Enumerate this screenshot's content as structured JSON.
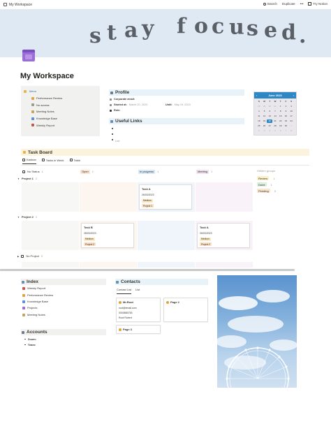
{
  "topbar": {
    "workspace": "My Workspace",
    "search": "Search",
    "duplicate": "Duplicate",
    "more": "•••",
    "try_notion": "Try Notion"
  },
  "cover": {
    "text": "stay focused."
  },
  "title": "My Workspace",
  "menu": {
    "label": "Menu",
    "items": [
      {
        "label": "Performance Review",
        "icon": "trophy-icon",
        "color": "#e3a33a"
      },
      {
        "label": "No access",
        "icon": "lock-icon",
        "color": "#9b9a97"
      },
      {
        "label": "Meeting Notes",
        "icon": "notes-icon",
        "color": "#c9a25b"
      },
      {
        "label": "Knowledge Base",
        "icon": "book-icon",
        "color": "#5b8fd6"
      },
      {
        "label": "Weekly Report",
        "icon": "report-icon",
        "color": "#d0534b"
      }
    ]
  },
  "profile": {
    "heading": "Profile",
    "email_label": "Corporate email:",
    "started_label": "Started at:",
    "started_value": "March 20, 2023",
    "until_label": "Until:",
    "until_value": "May 19, 2023",
    "role_label": "Role:"
  },
  "useful_links": {
    "heading": "Useful Links",
    "bullets": [
      "",
      "",
      ""
    ],
    "extra": "List"
  },
  "calendar": {
    "month": "June 2023",
    "prev": "‹",
    "next": "›",
    "dows": [
      "S",
      "M",
      "T",
      "W",
      "T",
      "F",
      "S"
    ],
    "days": [
      {
        "d": "28",
        "cls": "other"
      },
      {
        "d": "29",
        "cls": "other"
      },
      {
        "d": "30",
        "cls": "other"
      },
      {
        "d": "31",
        "cls": "other"
      },
      {
        "d": "1",
        "cls": ""
      },
      {
        "d": "2",
        "cls": ""
      },
      {
        "d": "3",
        "cls": ""
      },
      {
        "d": "4",
        "cls": ""
      },
      {
        "d": "5",
        "cls": ""
      },
      {
        "d": "6",
        "cls": ""
      },
      {
        "d": "7",
        "cls": ""
      },
      {
        "d": "8",
        "cls": ""
      },
      {
        "d": "9",
        "cls": ""
      },
      {
        "d": "10",
        "cls": ""
      },
      {
        "d": "11",
        "cls": ""
      },
      {
        "d": "12",
        "cls": ""
      },
      {
        "d": "13",
        "cls": ""
      },
      {
        "d": "14",
        "cls": ""
      },
      {
        "d": "15",
        "cls": ""
      },
      {
        "d": "16",
        "cls": ""
      },
      {
        "d": "17",
        "cls": ""
      },
      {
        "d": "18",
        "cls": ""
      },
      {
        "d": "19",
        "cls": ""
      },
      {
        "d": "20",
        "cls": "today"
      },
      {
        "d": "21",
        "cls": ""
      },
      {
        "d": "22",
        "cls": ""
      },
      {
        "d": "23",
        "cls": ""
      },
      {
        "d": "24",
        "cls": ""
      },
      {
        "d": "25",
        "cls": ""
      },
      {
        "d": "26",
        "cls": ""
      },
      {
        "d": "27",
        "cls": ""
      },
      {
        "d": "28",
        "cls": ""
      },
      {
        "d": "29",
        "cls": ""
      },
      {
        "d": "30",
        "cls": ""
      },
      {
        "d": "1",
        "cls": "other"
      },
      {
        "d": "2",
        "cls": "other"
      },
      {
        "d": "3",
        "cls": "other"
      },
      {
        "d": "4",
        "cls": "other"
      },
      {
        "d": "5",
        "cls": "other"
      },
      {
        "d": "6",
        "cls": "other"
      },
      {
        "d": "7",
        "cls": "other"
      },
      {
        "d": "8",
        "cls": "other"
      }
    ]
  },
  "task_board": {
    "heading": "Task Board",
    "tabs": [
      "Kanban",
      "Tasks in Week",
      "Table"
    ],
    "columns": [
      {
        "label": "No Status",
        "count": "1",
        "color": "transparent"
      },
      {
        "label": "Open",
        "count": "1",
        "color": "#fbe4d3"
      },
      {
        "label": "In progress",
        "count": "1",
        "color": "#d7e7f5"
      },
      {
        "label": "Meeting",
        "count": "1",
        "color": "#f1e1ef"
      }
    ],
    "hidden_groups_label": "Hidden groups",
    "hidden_groups": [
      {
        "label": "Review",
        "count": "1",
        "color": "#fbf0c7"
      },
      {
        "label": "Done",
        "count": "1",
        "color": "#dcefdf"
      },
      {
        "label": "Pending",
        "count": "0",
        "color": "#f9e6d0"
      }
    ],
    "groups": [
      {
        "label": "Project 1",
        "count": "2"
      },
      {
        "label": "Project 2",
        "count": "2"
      },
      {
        "label": "No Project",
        "count": "0"
      }
    ],
    "cards": {
      "task_a_1": {
        "title": "Task A",
        "date": "26/03/2023",
        "priority": "Medium",
        "project": "Project 1"
      },
      "task_b": {
        "title": "Task B",
        "date": "28/03/2023",
        "priority": "Medium",
        "project": "Project 2"
      },
      "task_a_2": {
        "title": "Task A",
        "date": "26/03/2023",
        "priority": "Medium",
        "project": "Project 2"
      }
    }
  },
  "index": {
    "heading": "Index",
    "items": [
      {
        "label": "Weekly Report",
        "icon": "report-icon",
        "color": "#d0534b"
      },
      {
        "label": "Performance Review",
        "icon": "trophy-icon",
        "color": "#e3a33a"
      },
      {
        "label": "Knowledge Base",
        "icon": "book-icon",
        "color": "#5b8fd6"
      },
      {
        "label": "Projects",
        "icon": "calendar-icon",
        "color": "#9a6dd7"
      },
      {
        "label": "Meeting Notes",
        "icon": "notes-icon",
        "color": "#c9a25b"
      }
    ]
  },
  "contacts": {
    "heading": "Contacts",
    "tabs": [
      "Contact List",
      "List"
    ],
    "cards": [
      {
        "name": "Mr.Root",
        "email": "root@email.com",
        "phone": "0000883753",
        "person": "Root Robert"
      },
      {
        "name": "Page 2"
      },
      {
        "name": "Page 3"
      }
    ]
  },
  "accounts": {
    "heading": "Accounts",
    "items": [
      "Zoom:",
      "Team:"
    ]
  }
}
